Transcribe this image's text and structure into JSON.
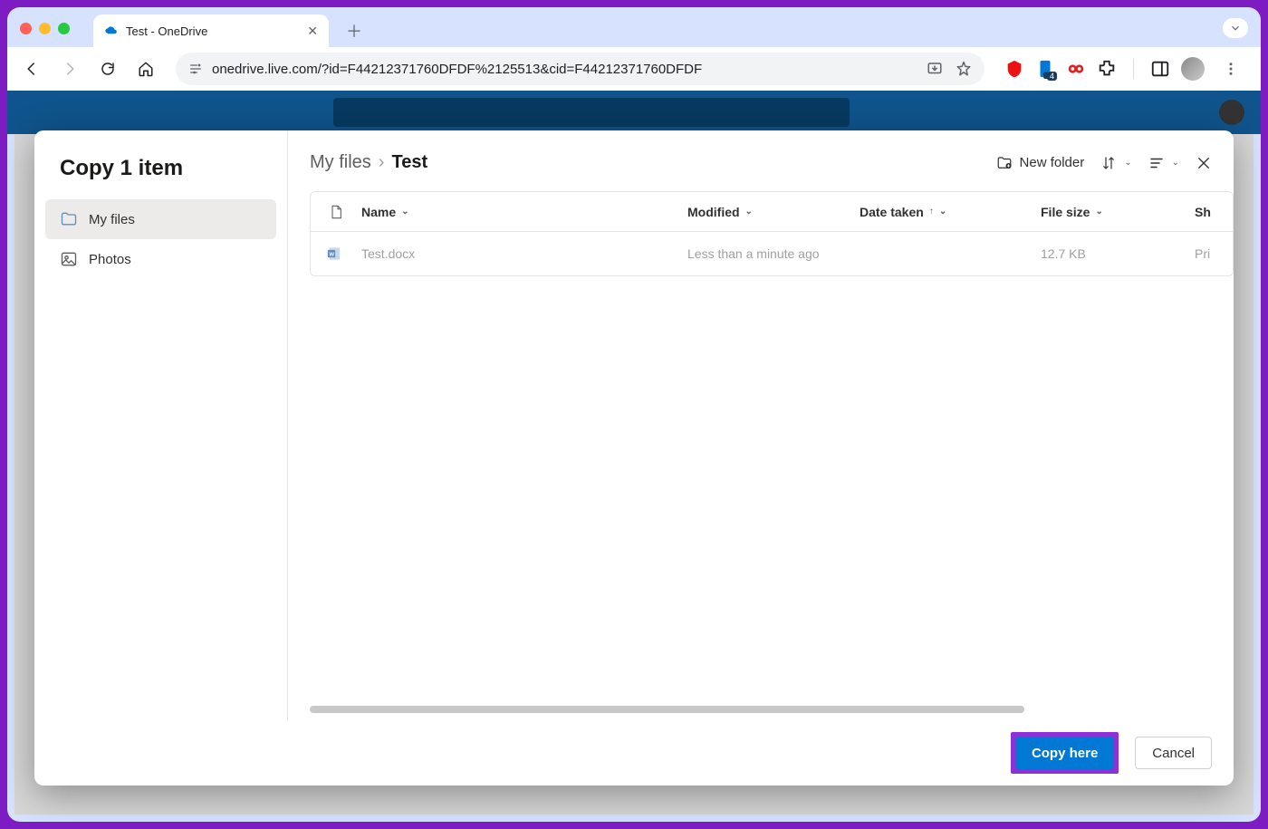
{
  "browser": {
    "tab_title": "Test - OneDrive",
    "url": "onedrive.live.com/?id=F44212371760DFDF%2125513&cid=F44212371760DFDF",
    "extension_badge": "4"
  },
  "dialog": {
    "title": "Copy 1 item",
    "sidebar": {
      "items": [
        {
          "label": "My files",
          "icon": "folder-icon",
          "active": true
        },
        {
          "label": "Photos",
          "icon": "photo-icon",
          "active": false
        }
      ]
    },
    "breadcrumb": {
      "root": "My files",
      "current": "Test"
    },
    "toolbar": {
      "new_folder": "New folder"
    },
    "columns": {
      "name": "Name",
      "modified": "Modified",
      "date_taken": "Date taken",
      "file_size": "File size",
      "sharing": "Sh"
    },
    "rows": [
      {
        "name": "Test.docx",
        "modified": "Less than a minute ago",
        "date_taken": "",
        "file_size": "12.7 KB",
        "sharing": "Pri"
      }
    ],
    "footer": {
      "primary": "Copy here",
      "secondary": "Cancel"
    }
  }
}
